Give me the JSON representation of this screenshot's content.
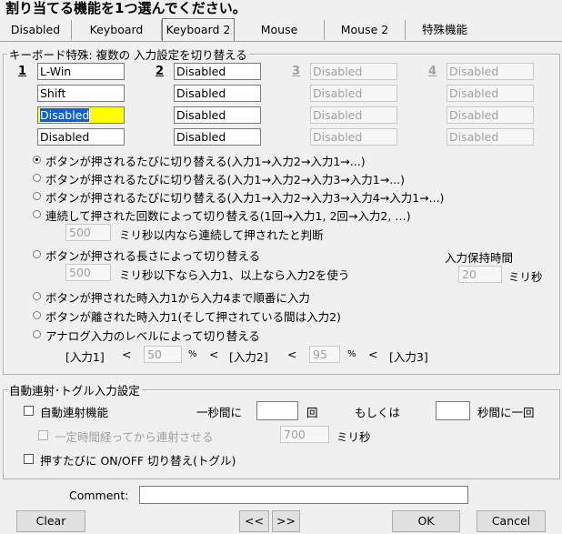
{
  "title": "割り当てる機能を1つ選んでください。",
  "tabs": [
    "Disabled",
    "Keyboard",
    "Keyboard 2",
    "Mouse",
    "Mouse 2",
    "特殊機能"
  ],
  "keyboard_group": {
    "legend": "キーボード特殊: 複数の 入力設定を切り替える",
    "columns": [
      {
        "num": "1",
        "fields": [
          "L-Win",
          "Shift",
          "Disabled",
          "Disabled"
        ]
      },
      {
        "num": "2",
        "fields": [
          "Disabled",
          "Disabled",
          "Disabled",
          "Disabled"
        ]
      },
      {
        "num": "3",
        "fields": [
          "Disabled",
          "Disabled",
          "Disabled",
          "Disabled"
        ]
      },
      {
        "num": "4",
        "fields": [
          "Disabled",
          "Disabled",
          "Disabled",
          "Disabled"
        ]
      }
    ],
    "options": [
      "ボタンが押されるたびに切り替える(入力1→入力2→入力1→...)",
      "ボタンが押されるたびに切り替える(入力1→入力2→入力3→入力1→...)",
      "ボタンが押されるたびに切り替える(入力1→入力2→入力3→入力4→入力1→...)",
      "連続して押された回数によって切り替える(1回→入力1, 2回→入力2, …)",
      "ボタンが押される長さによって切り替える",
      "ボタンが押された時入力1から入力4まで順番に入力",
      "ボタンが離された時入力1(そして押されている間は入力2)",
      "アナログ入力のレベルによって切り替える"
    ],
    "consecutive_ms": "500",
    "consecutive_text": "ミリ秒以内なら連続して押されたと判断",
    "length_ms": "500",
    "length_text": "ミリ秒以下なら入力1、以上なら入力2を使う",
    "hold_label": "入力保持時間",
    "hold_value": "20",
    "hold_unit": "ミリ秒",
    "analog": {
      "in1": "[入力1]",
      "lt1": "<",
      "v1": "50",
      "pct1": "%",
      "lt2": "<",
      "in2": "[入力2]",
      "lt3": "<",
      "v2": "95",
      "pct2": "%",
      "lt4": "<",
      "in3": "[入力3]"
    }
  },
  "rapid_group": {
    "legend": "自動連射･トグル入力設定",
    "auto_fire": "自動連射機能",
    "per_second": "一秒間に",
    "times": "回",
    "or": "もしくは",
    "once_per": "秒間に一回",
    "delay_label": "一定時間経ってから連射させる",
    "delay_value": "700",
    "ms": "ミリ秒",
    "toggle": "押すたびに ON/OFF 切り替え(トグル)"
  },
  "comment_label": "Comment:",
  "buttons": {
    "clear": "Clear",
    "prev": "<<",
    "next": ">>",
    "ok": "OK",
    "cancel": "Cancel"
  }
}
